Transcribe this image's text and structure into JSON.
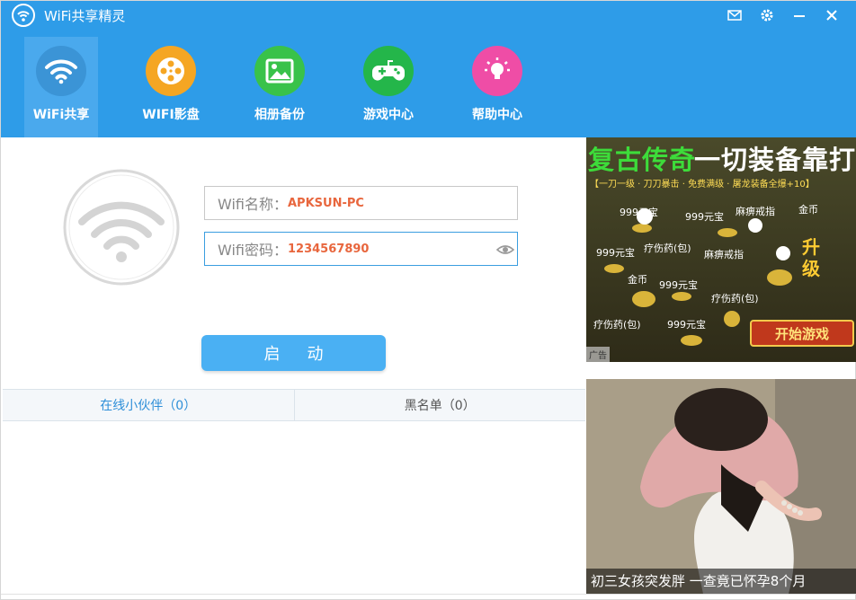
{
  "app": {
    "title": "WiFi共享精灵"
  },
  "nav": {
    "items": [
      {
        "label": "WiFi共享",
        "icon": "wifi-icon",
        "color": "#3b94d6",
        "active": true
      },
      {
        "label": "WIFI影盘",
        "icon": "film-reel-icon",
        "color": "#f5a623"
      },
      {
        "label": "相册备份",
        "icon": "picture-icon",
        "color": "#39c24a"
      },
      {
        "label": "游戏中心",
        "icon": "gamepad-icon",
        "color": "#24b64a"
      },
      {
        "label": "帮助中心",
        "icon": "lightbulb-icon",
        "color": "#ef4da6"
      }
    ]
  },
  "form": {
    "name_label": "Wifi名称：",
    "name_value": "APKSUN-PC",
    "password_label": "Wifi密码：",
    "password_value": "1234567890"
  },
  "start_button": "启动",
  "tabs": {
    "online": "在线小伙伴（0）",
    "blacklist": "黑名单（0）"
  },
  "ads": {
    "game": {
      "headline_green": "复古传奇",
      "headline_white": "一切装备靠打",
      "subline": "【一刀一级 · 刀刀暴击 · 免费满级 · 屠龙装备全爆+10】",
      "items": [
        "999元宝",
        "999元宝",
        "麻痹戒指",
        "金币",
        "999元宝",
        "疗伤药(包)",
        "麻痹戒指",
        "金币",
        "999元宝",
        "疗伤药(包)",
        "疗伤药(包)",
        "999元宝"
      ],
      "level_up": "升级",
      "play_button": "开始游戏",
      "tag": "广告"
    },
    "news": {
      "caption": "初三女孩突发胖 一查竟已怀孕8个月"
    }
  },
  "colors": {
    "accent": "#2e9ce8",
    "value": "#e8663d"
  }
}
